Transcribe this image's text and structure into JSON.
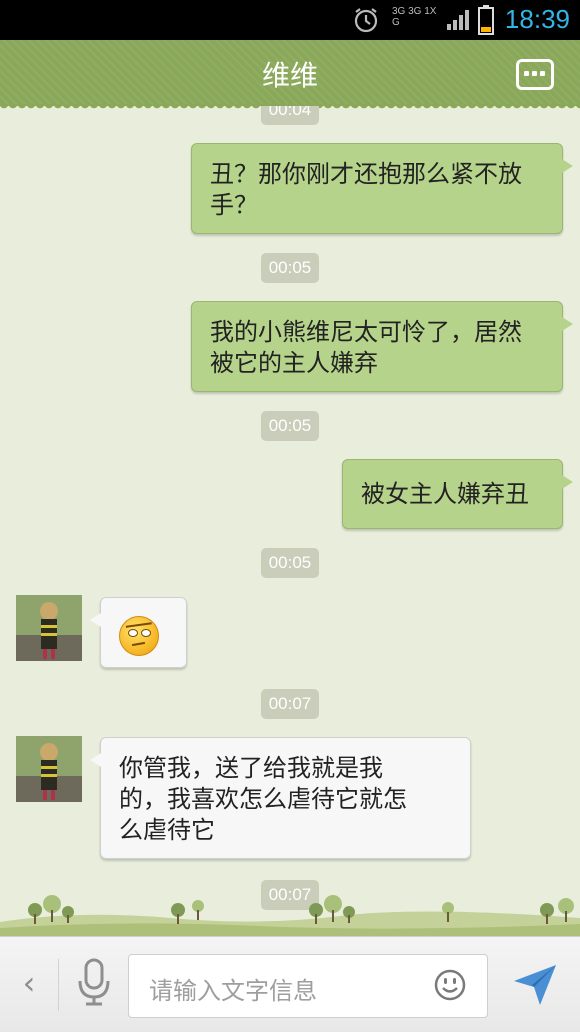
{
  "status_bar": {
    "time": "18:39",
    "network_label": "3G 3G 1X G"
  },
  "header": {
    "title": "维维",
    "menu_icon": "more-dots-icon"
  },
  "messages": [
    {
      "type": "timestamp",
      "text": "00:04"
    },
    {
      "type": "sent",
      "text": "丑？那你刚才还抱那么紧不放手？"
    },
    {
      "type": "timestamp",
      "text": "00:05"
    },
    {
      "type": "sent",
      "text": "我的小熊维尼太可怜了，居然被它的主人嫌弃"
    },
    {
      "type": "timestamp",
      "text": "00:05"
    },
    {
      "type": "sent",
      "text": "被女主人嫌弃丑"
    },
    {
      "type": "timestamp",
      "text": "00:05"
    },
    {
      "type": "received",
      "emoji": "annoyed-face-emoji"
    },
    {
      "type": "timestamp",
      "text": "00:07"
    },
    {
      "type": "received",
      "text": "你管我，送了给我就是我的，我喜欢怎么虐待它就怎么虐待它"
    },
    {
      "type": "timestamp",
      "text": "00:07"
    }
  ],
  "input_bar": {
    "placeholder": "请输入文字信息",
    "icons": [
      "back-chevron-icon",
      "microphone-icon",
      "emoji-smiley-icon",
      "send-icon"
    ]
  },
  "colors": {
    "header": "#8aa85a",
    "background": "#e9eedc",
    "sent_bubble": "#b6d38b",
    "received_bubble": "#f7f7f7",
    "time_accent": "#33b5e5"
  }
}
